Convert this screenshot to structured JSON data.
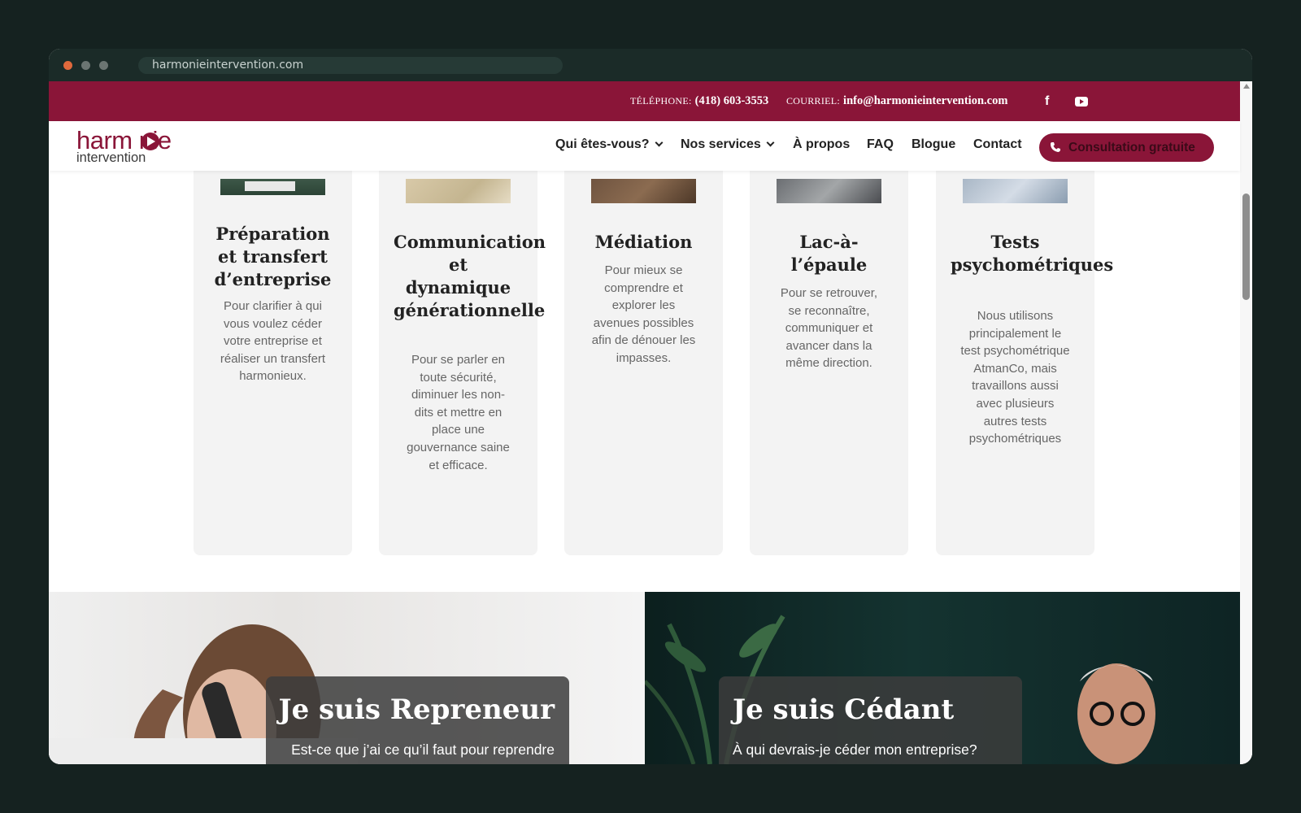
{
  "browser": {
    "url": "harmonieintervention.com"
  },
  "topbar": {
    "phone_label": "TÉLÉPHONE:",
    "phone": "(418) 603-3553",
    "email_label": "COURRIEL:",
    "email": "info@harmonieintervention.com"
  },
  "brand": {
    "name_top": "harm nie",
    "name_bottom": "intervention",
    "color": "#8a1538"
  },
  "nav": {
    "items": [
      {
        "label": "Qui êtes-vous?",
        "has_dropdown": true
      },
      {
        "label": "Nos services",
        "has_dropdown": true
      },
      {
        "label": "À propos",
        "has_dropdown": false
      },
      {
        "label": "FAQ",
        "has_dropdown": false
      },
      {
        "label": "Blogue",
        "has_dropdown": false
      },
      {
        "label": "Contact",
        "has_dropdown": false
      }
    ],
    "cta": "Consultation gratuite"
  },
  "services": [
    {
      "title": "Préparation et transfert d’entreprise",
      "description": "Pour clarifier à qui vous voulez céder votre entreprise et réaliser un transfert harmonieux."
    },
    {
      "title": "Communication et dynamique générationnelle",
      "description": "Pour se parler en toute sécurité, diminuer les non-dits et mettre en place une gouvernance saine et efficace."
    },
    {
      "title": "Médiation",
      "description": "Pour mieux se comprendre et explorer les avenues possibles afin de dénouer les impasses."
    },
    {
      "title": "Lac-à-l’épaule",
      "description": "Pour se retrouver, se reconnaître, communiquer et avancer dans la même direction."
    },
    {
      "title": "Tests psychométriques",
      "description": "Nous utilisons principalement le test psychométrique AtmanCo, mais travaillons aussi avec plusieurs autres tests psychométriques"
    }
  ],
  "panels": [
    {
      "title": "Je suis Repreneur",
      "text": "Est-ce que j’ai ce qu’il faut pour reprendre l’entreprise familiale? Est-ce que j’ai"
    },
    {
      "title": "Je suis Cédant",
      "text": "À qui devrais-je céder mon entreprise? Comment me faire confiance? Transférer"
    }
  ]
}
